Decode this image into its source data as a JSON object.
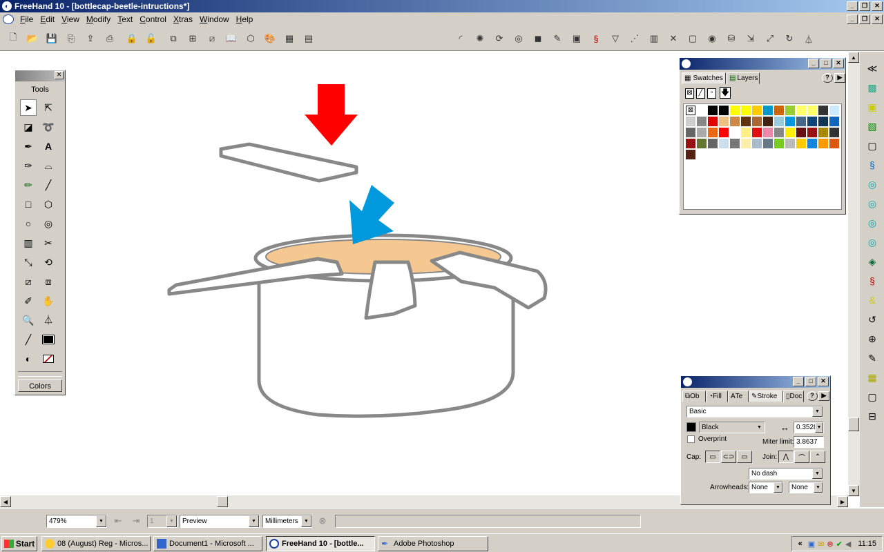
{
  "window": {
    "title": "FreeHand 10 - [bottlecap-beetle-intructions*]",
    "icon": "freehand-logo-icon"
  },
  "menu": [
    "File",
    "Edit",
    "View",
    "Modify",
    "Text",
    "Control",
    "Xtras",
    "Window",
    "Help"
  ],
  "toolbar": {
    "document_select": "bottlecap-beetle-intructions"
  },
  "tools_panel": {
    "label": "Tools",
    "colors_label": "Colors"
  },
  "swatches_panel": {
    "tabs": [
      "Swatches",
      "Layers"
    ],
    "swatches": [
      "#ffffff",
      "#000000",
      "#000000",
      "#ffff00",
      "#ffff00",
      "#ffcc00",
      "#0099cc",
      "#cc6600",
      "#99cc33",
      "#ffff66",
      "#ffff66",
      "#333333",
      "#ccebff",
      "#cccccc",
      "#888888",
      "#dd0000",
      "#f0c080",
      "#cc8844",
      "#663311",
      "#aa6633",
      "#442211",
      "#99ccdd",
      "#0099dd",
      "#446688",
      "#114477",
      "#113355",
      "#1166bb",
      "#666666",
      "#aaaaaa",
      "#ee6611",
      "#ff0000",
      "#ffffff",
      "#ffee88",
      "#dd1111",
      "#ee88aa",
      "#888888",
      "#ffee00",
      "#661111",
      "#991111",
      "#aa8800",
      "#333333",
      "#991111",
      "#667733",
      "#666666",
      "#ccddee",
      "#777777",
      "#ffeeaa",
      "#aabbcc",
      "#667788",
      "#77cc22",
      "#bbbbbb",
      "#ffcc00",
      "#1188dd",
      "#ff9900",
      "#dd5511",
      "#552211"
    ]
  },
  "stroke_panel": {
    "tabs": [
      "Ob",
      "Fill",
      "Te",
      "Stroke",
      "Doc"
    ],
    "type": "Basic",
    "color": "Black",
    "width": "0.3528",
    "overprint": "Overprint",
    "miter_label": "Miter limit:",
    "miter_value": "3.8637",
    "cap_label": "Cap:",
    "join_label": "Join:",
    "dash": "No dash",
    "arrowheads_label": "Arrowheads:",
    "arrow_start": "None",
    "arrow_end": "None"
  },
  "statusbar": {
    "zoom": "479%",
    "page": "1",
    "view_mode": "Preview",
    "units": "Millimeters"
  },
  "taskbar": {
    "start": "Start",
    "tasks": [
      "08 (August) Reg - Micros...",
      "Document1 - Microsoft ...",
      "FreeHand 10 - [bottle...",
      "Adobe Photoshop"
    ],
    "time": "11:15"
  },
  "colors": {
    "accent_red": "#ff0000",
    "accent_blue": "#0099dd",
    "cap_fill": "#f4c890",
    "outline": "#808080"
  }
}
